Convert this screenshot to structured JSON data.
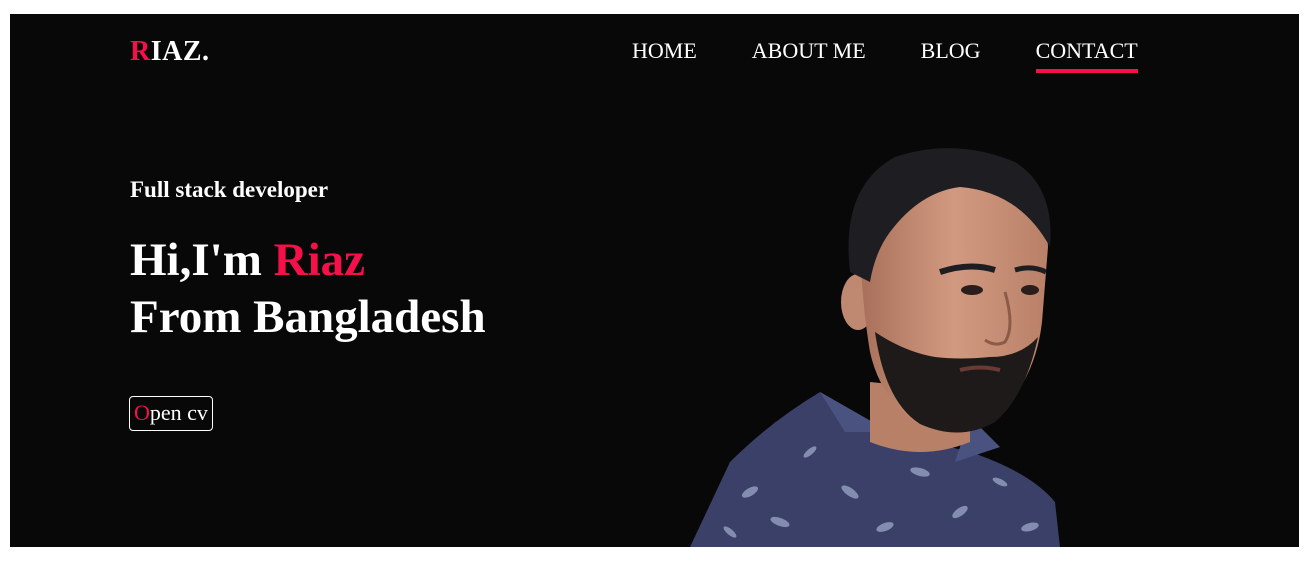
{
  "logo": {
    "first_letter": "R",
    "rest": "IAZ."
  },
  "nav": {
    "items": [
      {
        "label": "HOME"
      },
      {
        "label": "ABOUT ME"
      },
      {
        "label": "BLOG"
      },
      {
        "label": "CONTACT"
      }
    ],
    "active": "CONTACT"
  },
  "hero": {
    "subtitle": "Full stack developer",
    "greeting": "Hi,I'm ",
    "name": "Riaz",
    "line2": "From Bangladesh",
    "button": {
      "first_letter": "O",
      "rest": "pen cv"
    }
  },
  "colors": {
    "accent": "#f5104a",
    "background": "#080808",
    "text": "#ffffff"
  }
}
